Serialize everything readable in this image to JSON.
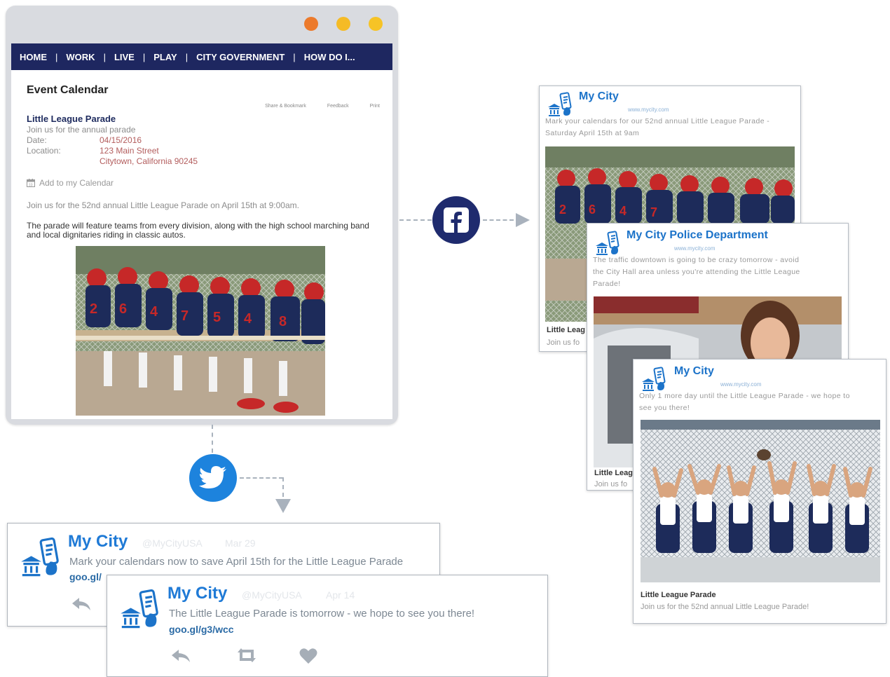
{
  "colors": {
    "navbar": "#1e2760",
    "traffic_lights": [
      "#ec7a2c",
      "#f5bb26",
      "#f6c326"
    ],
    "facebook_blue": "#1f2b6e",
    "twitter_blue": "#1d83dd",
    "accent_blue": "#1c73c9"
  },
  "nav": {
    "items": [
      "HOME",
      "WORK",
      "LIVE",
      "PLAY",
      "CITY GOVERNMENT",
      "HOW DO I..."
    ]
  },
  "calendar": {
    "heading": "Event Calendar",
    "share_links": [
      "Share & Bookmark",
      "Feedback",
      "Print"
    ],
    "event_title": "Little League Parade",
    "event_tagline": "Join us for the annual parade",
    "date_label": "Date:",
    "date_value": "04/15/2016",
    "location_label": "Location:",
    "location_line1": "123 Main Street",
    "location_line2": "Citytown, California 90245",
    "add_to_calendar": "Add to my Calendar",
    "paragraph1": "Join us for the 52nd annual Little League Parade on April 15th at 9:00am.",
    "paragraph2": "The parade will feature teams from every division, along with the high school marching band and local dignitaries riding in classic autos.",
    "photo_icon": "little-league-team-on-bench-photo"
  },
  "connectors": {
    "facebook_icon": "facebook-icon",
    "twitter_icon": "twitter-bird-icon"
  },
  "facebook_posts": [
    {
      "name": "My City",
      "handle": "www.mycity.com",
      "text_line1": "Mark your calendars for our 52nd annual Little League Parade -",
      "text_line2": "Saturday April 15th at 9am",
      "footer_title": "Little Leag",
      "footer_sub": "Join us fo"
    },
    {
      "name": "My City Police Department",
      "handle": "www.mycity.com",
      "text_line1": "The traffic downtown is going to be crazy tomorrow - avoid",
      "text_line2": "the City Hall area unless you're attending the Little League",
      "text_line3": "Parade!",
      "footer_title": "Little Leag",
      "footer_sub": "Join us fo"
    },
    {
      "name": "My City",
      "handle": "www.mycity.com",
      "text_line1": "Only 1 more day until the Little League Parade - we hope to",
      "text_line2": "see you there!",
      "footer_title": "Little League Parade",
      "footer_sub": "Join us for the 52nd annual Little League Parade!"
    }
  ],
  "tweets": [
    {
      "name": "My City",
      "handle": "@MyCityUSA",
      "date": "Mar 29",
      "text": "Mark your calendars now to save April 15th for the Little League Parade",
      "link": "goo.gl/"
    },
    {
      "name": "My City",
      "handle": "@MyCityUSA",
      "date": "Apr 14",
      "text": "The Little League Parade is tomorrow - we hope to see you there!",
      "link": "goo.gl/g3/wcc"
    }
  ]
}
